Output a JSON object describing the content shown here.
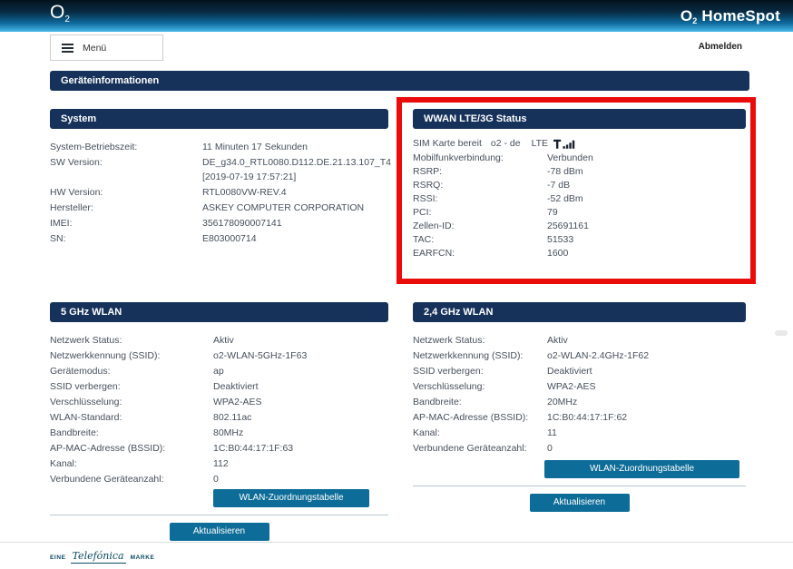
{
  "header": {
    "logo_o": "O",
    "logo_sub": "2",
    "product_o": "O",
    "product_sub": "2",
    "product_name": " HomeSpot"
  },
  "nav": {
    "menu_label": "Menü",
    "logout_label": "Abmelden"
  },
  "page_title": "Geräteinformationen",
  "panels": {
    "system": {
      "title": "System",
      "rows": [
        {
          "label": "System-Betriebszeit:",
          "value": "11 Minuten 17 Sekunden"
        },
        {
          "label": "SW Version:",
          "value": "DE_g34.0_RTL0080.D112.DE.21.13.107_T4 [2019-07-19 17:57:21]"
        },
        {
          "label": "HW Version:",
          "value": "RTL0080VW-REV.4"
        },
        {
          "label": "Hersteller:",
          "value": "ASKEY COMPUTER CORPORATION"
        },
        {
          "label": "IMEI:",
          "value": "356178090007141"
        },
        {
          "label": "SN:",
          "value": "E803000714"
        }
      ]
    },
    "wwan": {
      "title": "WWAN LTE/3G Status",
      "sim_status": "SIM Karte bereit",
      "operator": "o2 - de",
      "network_type": "LTE",
      "signal_icon": "cellular-signal-bars",
      "rows": [
        {
          "label": "Mobilfunkverbindung:",
          "value": "Verbunden"
        },
        {
          "label": "RSRP:",
          "value": "-78 dBm"
        },
        {
          "label": "RSRQ:",
          "value": "-7 dB"
        },
        {
          "label": "RSSI:",
          "value": "-52 dBm"
        },
        {
          "label": "PCI:",
          "value": "79"
        },
        {
          "label": "Zellen-ID:",
          "value": "25691161"
        },
        {
          "label": "TAC:",
          "value": "51533"
        },
        {
          "label": "EARFCN:",
          "value": "1600"
        }
      ]
    },
    "wlan5": {
      "title": "5 GHz WLAN",
      "rows": [
        {
          "label": "Netzwerk Status:",
          "value": "Aktiv"
        },
        {
          "label": "Netzwerkkennung (SSID):",
          "value": "o2-WLAN-5GHz-1F63"
        },
        {
          "label": "Gerätemodus:",
          "value": "ap"
        },
        {
          "label": "SSID verbergen:",
          "value": "Deaktiviert"
        },
        {
          "label": "Verschlüsselung:",
          "value": "WPA2-AES"
        },
        {
          "label": "WLAN-Standard:",
          "value": "802.11ac"
        },
        {
          "label": "Bandbreite:",
          "value": "80MHz"
        },
        {
          "label": "AP-MAC-Adresse (BSSID):",
          "value": "1C:B0:44:17:1F:63"
        },
        {
          "label": "Kanal:",
          "value": "112"
        },
        {
          "label": "Verbundene Geräteanzahl:",
          "value": "0"
        }
      ],
      "buttons": {
        "mapping_table": "WLAN-Zuordnungstabelle",
        "refresh": "Aktualisieren"
      }
    },
    "wlan24": {
      "title": "2,4 GHz WLAN",
      "rows": [
        {
          "label": "Netzwerk Status:",
          "value": "Aktiv"
        },
        {
          "label": "Netzwerkkennung (SSID):",
          "value": "o2-WLAN-2.4GHz-1F62"
        },
        {
          "label": "SSID verbergen:",
          "value": "Deaktiviert"
        },
        {
          "label": "Verschlüsselung:",
          "value": "WPA2-AES"
        },
        {
          "label": "Bandbreite:",
          "value": "20MHz"
        },
        {
          "label": "AP-MAC-Adresse (BSSID):",
          "value": "1C:B0:44:17:1F:62"
        },
        {
          "label": "Kanal:",
          "value": "11"
        },
        {
          "label": "Verbundene Geräteanzahl:",
          "value": "0"
        }
      ],
      "buttons": {
        "mapping_table": "WLAN-Zuordnungstabelle",
        "refresh": "Aktualisieren"
      }
    }
  },
  "footer": {
    "eine": "EINE",
    "brand": "Telefónica",
    "marke": "MARKE"
  },
  "colors": {
    "header_gradient_top": "#03121d",
    "header_gradient_bottom": "#47b9e9",
    "section_bar": "#16325a",
    "button": "#0e6d98",
    "highlight_border": "#ea0b0b",
    "text": "#46505c"
  }
}
